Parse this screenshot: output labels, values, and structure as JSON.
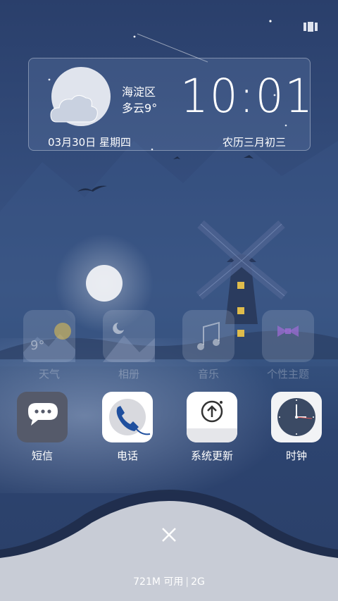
{
  "weather": {
    "district": "海淀区",
    "condition": "多云",
    "temperature": "9°",
    "time": "10:01",
    "date": "03月30日 星期四",
    "lunar": "农历三月初三"
  },
  "faded_apps": [
    {
      "label": "天气",
      "icon": "weather-icon",
      "value": "9°"
    },
    {
      "label": "相册",
      "icon": "album-icon"
    },
    {
      "label": "音乐",
      "icon": "music-icon"
    },
    {
      "label": "个性主题",
      "icon": "theme-icon"
    }
  ],
  "apps": [
    {
      "label": "短信",
      "icon": "message-icon"
    },
    {
      "label": "电话",
      "icon": "phone-icon"
    },
    {
      "label": "系统更新",
      "icon": "update-icon"
    },
    {
      "label": "时钟",
      "icon": "clock-icon"
    }
  ],
  "bottom": {
    "memory_text": "721M 可用",
    "network": "2G"
  },
  "colors": {
    "bg_top": "#2a3f6b",
    "bg_mid": "#3a5583",
    "panel": "#c8ccd6",
    "message_tile": "#555a6a",
    "phone_blue": "#1f4f9e",
    "clock_face": "#3b4a64"
  }
}
